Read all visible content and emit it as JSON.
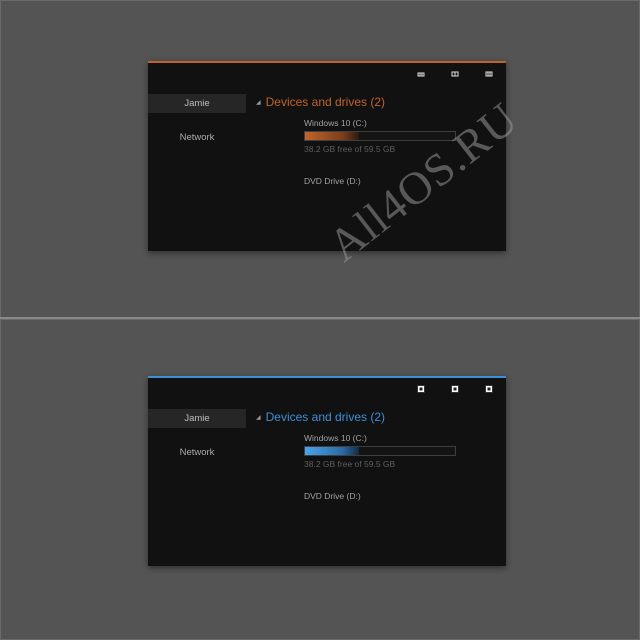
{
  "variants": [
    {
      "accent": "#c0642c",
      "group_header": "Devices and drives (2)",
      "sidebar": [
        "Jamie",
        "Network"
      ],
      "drives": [
        {
          "name": "Windows 10 (C:)",
          "usage_fraction": 0.36,
          "free_text": "38.2 GB free of 59.5 GB"
        },
        {
          "name": "DVD Drive (D:)"
        }
      ],
      "caption_icons": [
        "minimize-icon",
        "maximize-icon",
        "close-icon"
      ]
    },
    {
      "accent": "#3d8fd8",
      "group_header": "Devices and drives (2)",
      "sidebar": [
        "Jamie",
        "Network"
      ],
      "drives": [
        {
          "name": "Windows 10 (C:)",
          "usage_fraction": 0.36,
          "free_text": "38.2 GB free of 59.5 GB"
        },
        {
          "name": "DVD Drive (D:)"
        }
      ],
      "caption_icons": [
        "minimize-icon",
        "maximize-icon",
        "close-icon"
      ]
    }
  ],
  "watermark": "All4OS.RU"
}
